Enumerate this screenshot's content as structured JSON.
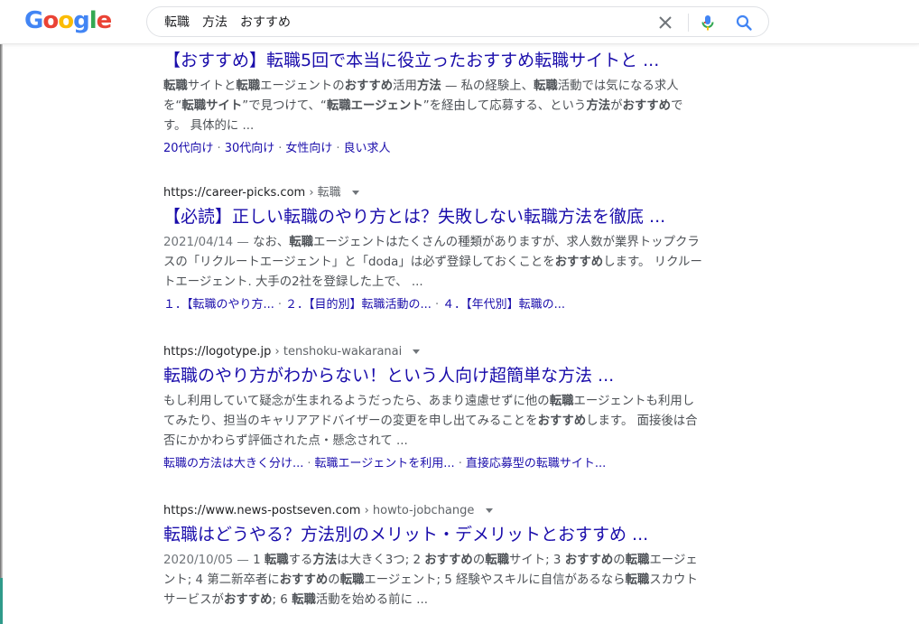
{
  "search": {
    "query": "転職　方法　おすすめ"
  },
  "logo": {
    "letters": [
      "G",
      "o",
      "o",
      "g",
      "l",
      "e"
    ],
    "colors": [
      "#4285f4",
      "#ea4335",
      "#fbbc05",
      "#4285f4",
      "#34a853",
      "#ea4335"
    ]
  },
  "results": [
    {
      "title": "【おすすめ】転職5回で本当に役立ったおすすめ転職サイトと ...",
      "snippet_parts": [
        {
          "t": "転職",
          "b": true
        },
        {
          "t": "サイトと",
          "b": false
        },
        {
          "t": "転職",
          "b": true
        },
        {
          "t": "エージェントの",
          "b": false
        },
        {
          "t": "おすすめ",
          "b": true
        },
        {
          "t": "活用",
          "b": false
        },
        {
          "t": "方法",
          "b": true
        },
        {
          "t": " — 私の経験上、",
          "b": false
        },
        {
          "t": "転職",
          "b": true
        },
        {
          "t": "活動では気になる求人を“",
          "b": false
        },
        {
          "t": "転職サイト",
          "b": true
        },
        {
          "t": "”で見つけて、“",
          "b": false
        },
        {
          "t": "転職エージェント",
          "b": true
        },
        {
          "t": "”を経由して応募する、という",
          "b": false
        },
        {
          "t": "方法",
          "b": true
        },
        {
          "t": "が",
          "b": false
        },
        {
          "t": "おすすめ",
          "b": true
        },
        {
          "t": "です。 具体的に ...",
          "b": false
        }
      ],
      "sitelinks": [
        "20代向け",
        "30代向け",
        "女性向け",
        "良い求人"
      ]
    },
    {
      "url": "https://career-picks.com",
      "breadcrumb": "› 転職",
      "title": "【必読】正しい転職のやり方とは？失敗しない転職方法を徹底 ...",
      "date": "2021/04/14 — ",
      "snippet_parts": [
        {
          "t": "なお、",
          "b": false
        },
        {
          "t": "転職",
          "b": true
        },
        {
          "t": "エージェントはたくさんの種類がありますが、求人数が業界トップクラスの「リクルートエージェント」と「doda」は必ず登録しておくことを",
          "b": false
        },
        {
          "t": "おすすめ",
          "b": true
        },
        {
          "t": "します。 リクルートエージェント. 大手の2社を登録した上で、 ...",
          "b": false
        }
      ],
      "sitelinks": [
        "１．【転職のやり方...",
        "２．【目的別】転職活動の...",
        "４．【年代別】転職の..."
      ]
    },
    {
      "url": "https://logotype.jp",
      "breadcrumb": "› tenshoku-wakaranai",
      "title": "転職のやり方がわからない！という人向け超簡単な方法 ...",
      "snippet_parts": [
        {
          "t": "もし利用していて疑念が生まれるようだったら、あまり遠慮せずに他の",
          "b": false
        },
        {
          "t": "転職",
          "b": true
        },
        {
          "t": "エージェントも利用してみたり、担当のキャリアアドバイザーの変更を申し出てみることを",
          "b": false
        },
        {
          "t": "おすすめ",
          "b": true
        },
        {
          "t": "します。 面接後は合否にかかわらず評価された点・懸念されて ...",
          "b": false
        }
      ],
      "sitelinks": [
        "転職の方法は大きく分け...",
        "転職エージェントを利用...",
        "直接応募型の転職サイト..."
      ]
    },
    {
      "url": "https://www.news-postseven.com",
      "breadcrumb": "› howto-jobchange",
      "title": "転職はどうやる？方法別のメリット・デメリットとおすすめ ...",
      "date": "2020/10/05 — ",
      "snippet_parts": [
        {
          "t": "1 ",
          "b": false
        },
        {
          "t": "転職",
          "b": true
        },
        {
          "t": "する",
          "b": false
        },
        {
          "t": "方法",
          "b": true
        },
        {
          "t": "は大きく3つ; 2 ",
          "b": false
        },
        {
          "t": "おすすめ",
          "b": true
        },
        {
          "t": "の",
          "b": false
        },
        {
          "t": "転職",
          "b": true
        },
        {
          "t": "サイト; 3 ",
          "b": false
        },
        {
          "t": "おすすめ",
          "b": true
        },
        {
          "t": "の",
          "b": false
        },
        {
          "t": "転職",
          "b": true
        },
        {
          "t": "エージェント; 4 第二新卒者に",
          "b": false
        },
        {
          "t": "おすすめ",
          "b": true
        },
        {
          "t": "の",
          "b": false
        },
        {
          "t": "転職",
          "b": true
        },
        {
          "t": "エージェント; 5 経験やスキルに自信があるなら",
          "b": false
        },
        {
          "t": "転職",
          "b": true
        },
        {
          "t": "スカウトサービスが",
          "b": false
        },
        {
          "t": "おすすめ",
          "b": true
        },
        {
          "t": "; 6 ",
          "b": false
        },
        {
          "t": "転職",
          "b": true
        },
        {
          "t": "活動を始める前に ...",
          "b": false
        }
      ]
    }
  ]
}
